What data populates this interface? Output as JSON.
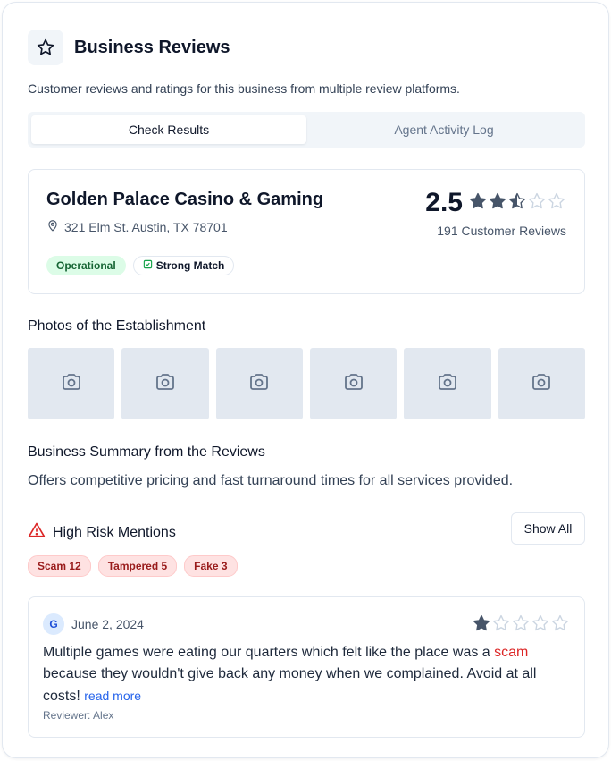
{
  "header": {
    "title": "Business Reviews",
    "icon": "star-icon",
    "subtitle": "Customer reviews and ratings for this business from multiple review platforms."
  },
  "tabs": [
    {
      "label": "Check Results",
      "active": true
    },
    {
      "label": "Agent Activity Log",
      "active": false
    }
  ],
  "business": {
    "name": "Golden Palace Casino & Gaming",
    "address": "321 Elm St. Austin, TX 78701",
    "status_badge": "Operational",
    "match_badge": "Strong Match",
    "rating": "2.5",
    "rating_value": 2.5,
    "review_count": "191 Customer Reviews"
  },
  "photos": {
    "title": "Photos of the Establishment",
    "count": 6,
    "icon": "camera-icon"
  },
  "summary": {
    "title": "Business Summary from the Reviews",
    "text": "Offers competitive pricing and fast turnaround times for all services provided."
  },
  "risk": {
    "title": "High Risk Mentions",
    "icon": "warning-triangle-icon",
    "show_all_label": "Show All",
    "tags": [
      "Scam 12",
      "Tampered 5",
      "Fake 3"
    ]
  },
  "review": {
    "avatar_letter": "G",
    "date": "June 2, 2024",
    "rating_value": 1,
    "text_before": "Multiple games were eating our quarters which felt like the place was a ",
    "highlight": "scam",
    "text_after": " because they wouldn't give back any money when we complained. Avoid at all costs!",
    "read_more": "read more",
    "author": "Reviewer: Alex"
  },
  "colors": {
    "star_filled": "#475569",
    "star_empty": "#cbd5e1",
    "risk_red": "#dc2626",
    "link_blue": "#2563eb"
  }
}
